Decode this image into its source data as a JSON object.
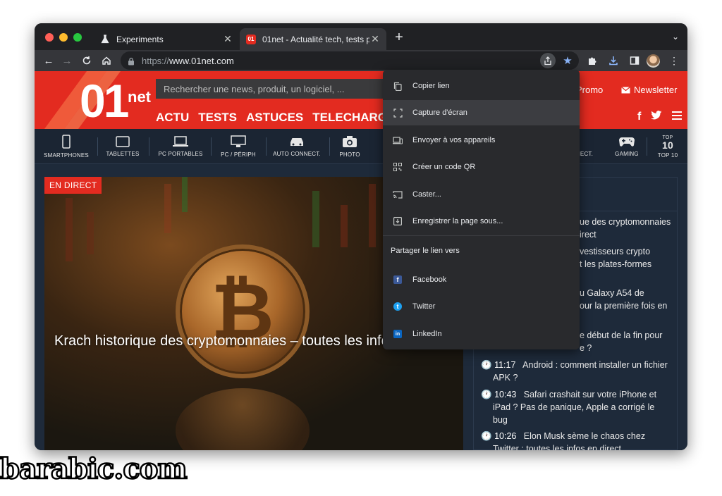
{
  "browser": {
    "tabs": [
      {
        "title": "Experiments",
        "icon": "flask-icon"
      },
      {
        "title": "01net - Actualité tech, tests pr",
        "icon": "01net-favicon",
        "favicon_text": "01"
      }
    ],
    "url_scheme": "https://",
    "url_host": "www.01net.com"
  },
  "site": {
    "logo_main": "01",
    "logo_suffix": "net",
    "search_placeholder": "Rechercher une news, produit, un logiciel, ...",
    "nav": [
      "ACTU",
      "TESTS",
      "ASTUCES",
      "TELECHARGER"
    ],
    "promo": "Promo",
    "newsletter": "Newsletter",
    "categories": [
      {
        "label": "SMARTPHONES",
        "icon": "smartphone-icon"
      },
      {
        "label": "TABLETTES",
        "icon": "tablet-icon"
      },
      {
        "label": "PC PORTABLES",
        "icon": "laptop-icon"
      },
      {
        "label": "PC / PÉRIPH",
        "icon": "monitor-icon"
      },
      {
        "label": "AUTO CONNECT.",
        "icon": "car-icon"
      },
      {
        "label": "PHOTO",
        "icon": "camera-icon"
      },
      {
        "label": "NECT.",
        "icon": "connected-icon"
      },
      {
        "label": "GAMING",
        "icon": "gamepad-icon"
      },
      {
        "label": "TOP 10",
        "icon": "top10-icon",
        "badge_top": "TOP",
        "badge_num": "10"
      }
    ],
    "live_badge": "EN DIRECT",
    "headline": "Krach historique des cryptomonnaies – toutes les info",
    "sidebar": [
      {
        "time": "",
        "text": "ue des cryptomonnaies",
        "text2": "irect"
      },
      {
        "time": "",
        "text": "vestisseurs crypto",
        "text2": "t les plates-formes"
      },
      {
        "time": "",
        "text": "u Galaxy A54 de",
        "text2": "our la première fois en"
      },
      {
        "time": "",
        "text": "e début de la fin pour",
        "text2": "e ?"
      },
      {
        "time": "11:17",
        "text": "Android : comment installer un fichier",
        "text2": "APK ?"
      },
      {
        "time": "10:43",
        "text": "Safari crashait sur votre iPhone et",
        "text2": "iPad ? Pas de panique, Apple a corrigé le",
        "text3": "bug"
      },
      {
        "time": "10:26",
        "text": "Elon Musk sème le chaos chez",
        "text2": "Twitter : toutes les infos en direct"
      }
    ]
  },
  "share_menu": {
    "items": [
      {
        "label": "Copier lien",
        "icon": "copy-icon"
      },
      {
        "label": "Capture d'écran",
        "icon": "screenshot-icon"
      },
      {
        "label": "Envoyer à vos appareils",
        "icon": "devices-icon"
      },
      {
        "label": "Créer un code QR",
        "icon": "qr-code-icon"
      },
      {
        "label": "Caster...",
        "icon": "cast-icon"
      },
      {
        "label": "Enregistrer la page sous...",
        "icon": "save-page-icon"
      }
    ],
    "section_title": "Partager le lien vers",
    "social": [
      {
        "label": "Facebook",
        "icon": "facebook-icon",
        "glyph": "f",
        "color": "#3b5998"
      },
      {
        "label": "Twitter",
        "icon": "twitter-icon",
        "glyph": "t",
        "color": "#1da1f2"
      },
      {
        "label": "LinkedIn",
        "icon": "linkedin-icon",
        "glyph": "in",
        "color": "#0a66c2"
      }
    ]
  },
  "watermark": "barabic.com",
  "colors": {
    "brand_red": "#e32b20",
    "page_bg": "#1e2a3a",
    "menu_bg": "#292a2d",
    "accent_blue": "#8ab4f8"
  }
}
